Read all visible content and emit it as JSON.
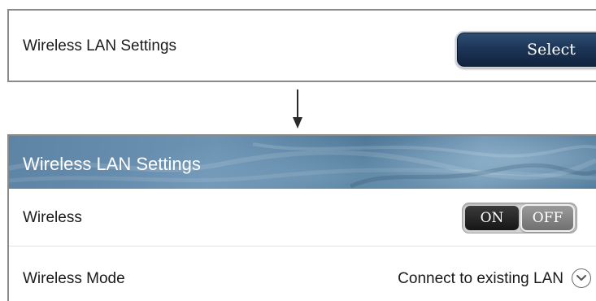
{
  "top": {
    "setting_label": "Wireless LAN Settings",
    "select_label": "Select"
  },
  "panel": {
    "title": "Wireless LAN Settings",
    "wireless": {
      "label": "Wireless",
      "on_label": "ON",
      "off_label": "OFF",
      "state": "OFF"
    },
    "mode": {
      "label": "Wireless Mode",
      "value": "Connect to existing LAN",
      "icon": "chevron-down-icon"
    }
  },
  "colors": {
    "select_button": "#1d3658",
    "header": "#5d84a5",
    "toggle_on": "#2a2a2a",
    "toggle_off": "#808080"
  }
}
